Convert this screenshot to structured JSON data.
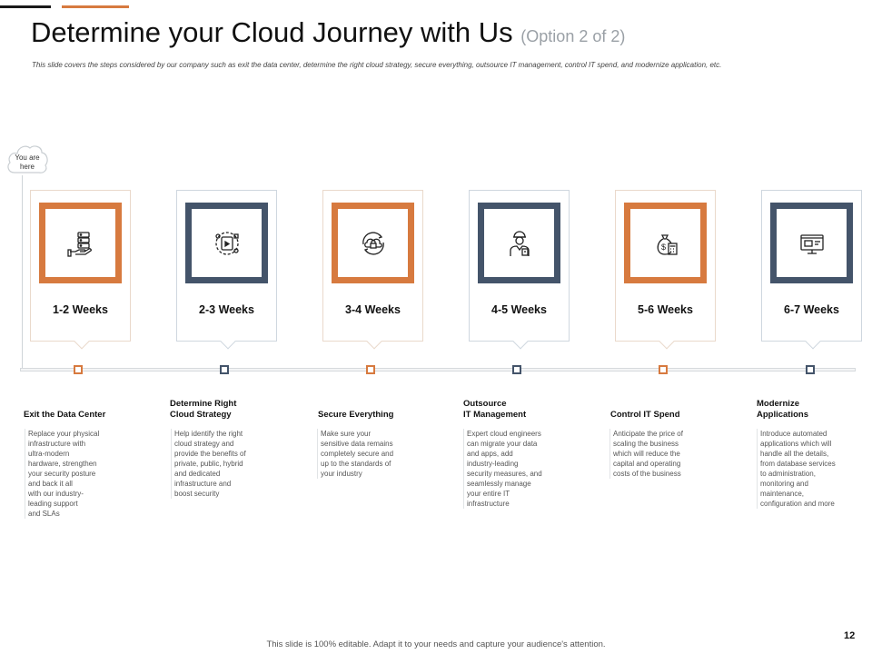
{
  "slide": {
    "title": "Determine your Cloud Journey with Us",
    "subtitle": "(Option 2 of 2)",
    "description": "This slide covers the steps considered by our company  such as exit the data center,  determine  the right cloud strategy, secure everything, outsource IT management,   control IT spend, and modernize  application, etc.",
    "you_are_here": "You are\nhere",
    "footer": "This slide is 100% editable.  Adapt it to your needs and capture your audience's attention.",
    "page_number": "12"
  },
  "colors": {
    "orange": "#d77a3f",
    "navy": "#44546a",
    "title": "#111111",
    "subtitle": "#9aa0a6"
  },
  "steps": [
    {
      "weeks": "1-2 Weeks",
      "title": "Exit the Data Center",
      "icon": "server-hand-icon",
      "color": "orange",
      "body": "Replace your physical\ninfrastructure with\nultra-modern\nhardware,  strengthen\nyour security posture\nand back it all\nwith our industry-\nleading support\nand SLAs"
    },
    {
      "weeks": "2-3 Weeks",
      "title": "Determine Right\nCloud Strategy",
      "icon": "cloud-strategy-devices-icon",
      "color": "navy",
      "body": "Help identify the right\ncloud strategy and\nprovide the benefits of\nprivate, public, hybrid\nand dedicated\ninfrastructure and\nboost security"
    },
    {
      "weeks": "3-4 Weeks",
      "title": "Secure Everything",
      "icon": "cloud-lock-icon",
      "color": "orange",
      "body": "Make sure your\nsensitive data remains\ncompletely secure and\nup to the standards of\nyour industry"
    },
    {
      "weeks": "4-5 Weeks",
      "title": "Outsource\nIT Management",
      "icon": "engineer-icon",
      "color": "navy",
      "body": "Expert cloud engineers\ncan migrate your data\nand apps, add\nindustry-leading\nsecurity measures, and\nseamlessly manage\nyour entire IT\ninfrastructure"
    },
    {
      "weeks": "5-6 Weeks",
      "title": "Control IT Spend",
      "icon": "money-bag-calculator-icon",
      "color": "orange",
      "body": "Anticipate the price of\nscaling the business\nwhich will reduce the\ncapital and operating\ncosts of the business"
    },
    {
      "weeks": "6-7 Weeks",
      "title": "Modernize\nApplications",
      "icon": "monitor-app-icon",
      "color": "navy",
      "body": "Introduce automated\napplications which will\nhandle all the details,\nfrom database services\nto administration,\nmonitoring and\nmaintenance,\nconfiguration and more"
    }
  ]
}
